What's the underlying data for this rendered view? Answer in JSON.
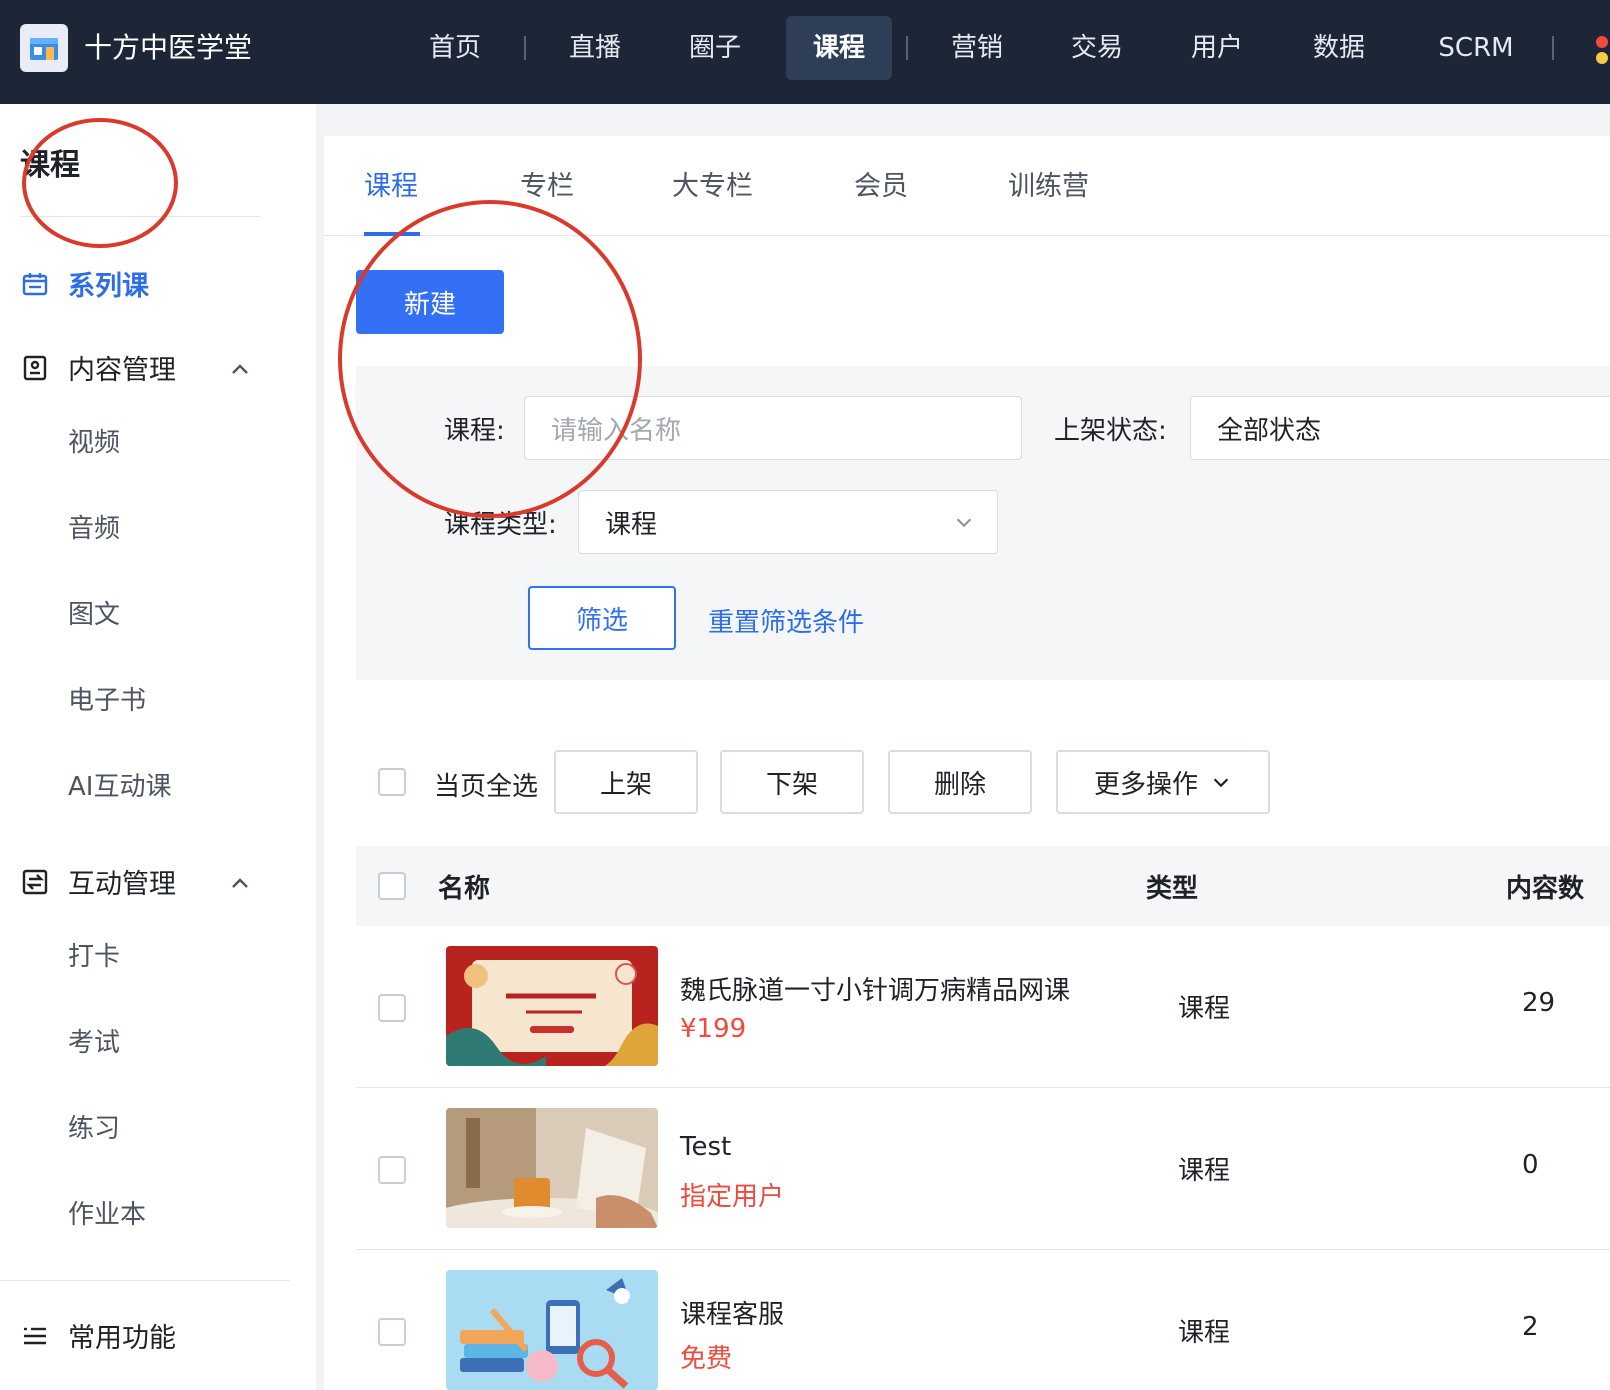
{
  "app": {
    "title": "十方中医学堂"
  },
  "topnav": {
    "items": [
      {
        "label": "首页"
      },
      {
        "label": "直播"
      },
      {
        "label": "圈子"
      },
      {
        "label": "课程",
        "active": true
      },
      {
        "label": "营销"
      },
      {
        "label": "交易"
      },
      {
        "label": "用户"
      },
      {
        "label": "数据"
      },
      {
        "label": "SCRM"
      }
    ]
  },
  "sidebar": {
    "title": "课程",
    "series": "系列课",
    "content_group": "内容管理",
    "content_items": [
      "视频",
      "音频",
      "图文",
      "电子书",
      "AI互动课"
    ],
    "interaction_group": "互动管理",
    "interaction_items": [
      "打卡",
      "考试",
      "练习",
      "作业本"
    ],
    "common": "常用功能"
  },
  "tabs": [
    "课程",
    "专栏",
    "大专栏",
    "会员",
    "训练营"
  ],
  "actions": {
    "new": "新建"
  },
  "filters": {
    "course_label": "课程:",
    "course_placeholder": "请输入名称",
    "status_label": "上架状态:",
    "status_value": "全部状态",
    "type_label": "课程类型:",
    "type_value": "课程",
    "filter_btn": "筛选",
    "reset_link": "重置筛选条件"
  },
  "bulk": {
    "select_all": "当页全选",
    "publish": "上架",
    "unpublish": "下架",
    "delete": "删除",
    "more": "更多操作"
  },
  "table": {
    "headers": {
      "name": "名称",
      "type": "类型",
      "count": "内容数"
    },
    "rows": [
      {
        "name": "魏氏脉道一寸小针调万病精品网课",
        "price": "¥199",
        "type": "课程",
        "count": "29"
      },
      {
        "name": "Test",
        "price": "指定用户",
        "type": "课程",
        "count": "0"
      },
      {
        "name": "课程客服",
        "price": "免费",
        "type": "课程",
        "count": "2"
      }
    ]
  },
  "colors": {
    "accent": "#3370f5",
    "topbar": "#1d2636",
    "price": "#f04a3e",
    "annotation": "#d93a2b"
  }
}
